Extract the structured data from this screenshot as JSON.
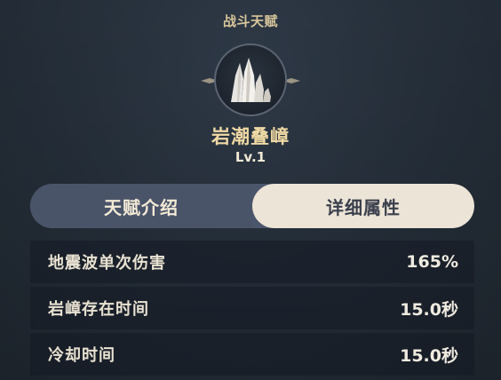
{
  "header": {
    "category": "战斗天赋"
  },
  "talent": {
    "name": "岩潮叠嶂",
    "level": "Lv.1",
    "icon": "rock-spire-icon"
  },
  "tabs": [
    {
      "label": "天赋介绍",
      "active": false
    },
    {
      "label": "详细属性",
      "active": true
    }
  ],
  "attributes": [
    {
      "name": "地震波单次伤害",
      "value": "165%"
    },
    {
      "name": "岩嶂存在时间",
      "value": "15.0秒"
    },
    {
      "name": "冷却时间",
      "value": "15.0秒"
    }
  ],
  "colors": {
    "gold": "#d7c59a",
    "tab_active_bg": "#ece4d6",
    "tab_inactive_bg": "#4a5469"
  }
}
